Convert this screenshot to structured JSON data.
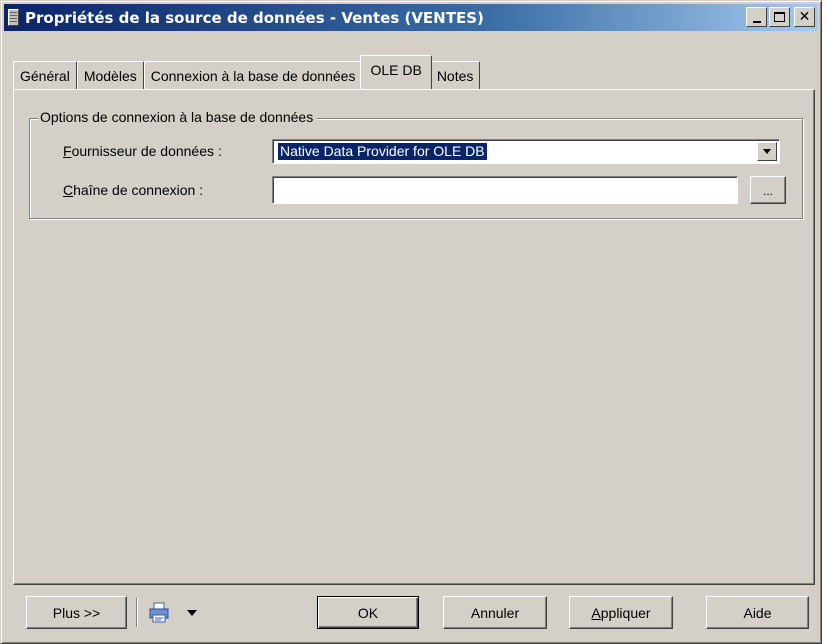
{
  "window": {
    "title": "Propriétés de la source de données - Ventes (VENTES)"
  },
  "tabs": [
    {
      "label": "Général",
      "active": false
    },
    {
      "label": "Modèles",
      "active": false
    },
    {
      "label": "Connexion à la base de données",
      "active": false
    },
    {
      "label": "OLE DB",
      "active": true
    },
    {
      "label": "Notes",
      "active": false
    }
  ],
  "group": {
    "legend": "Options de connexion à la base de données",
    "provider": {
      "label_mnemonic": "F",
      "label_rest": "ournisseur de données :",
      "value": "Native Data Provider for OLE DB"
    },
    "connection_string": {
      "label_mnemonic": "C",
      "label_rest": "haîne de connexion :",
      "value": "",
      "browse_label": "..."
    }
  },
  "buttons": {
    "more": "Plus >>",
    "ok": "OK",
    "cancel": "Annuler",
    "apply_mnemonic": "A",
    "apply_rest": "ppliquer",
    "help": "Aide"
  },
  "icons": {
    "print": "printer-icon",
    "print_dropdown": "chevron-down-icon"
  },
  "colors": {
    "titlebar_start": "#0a246a",
    "titlebar_end": "#a6caf0",
    "face": "#d4d0c8",
    "selection": "#0a246a"
  }
}
